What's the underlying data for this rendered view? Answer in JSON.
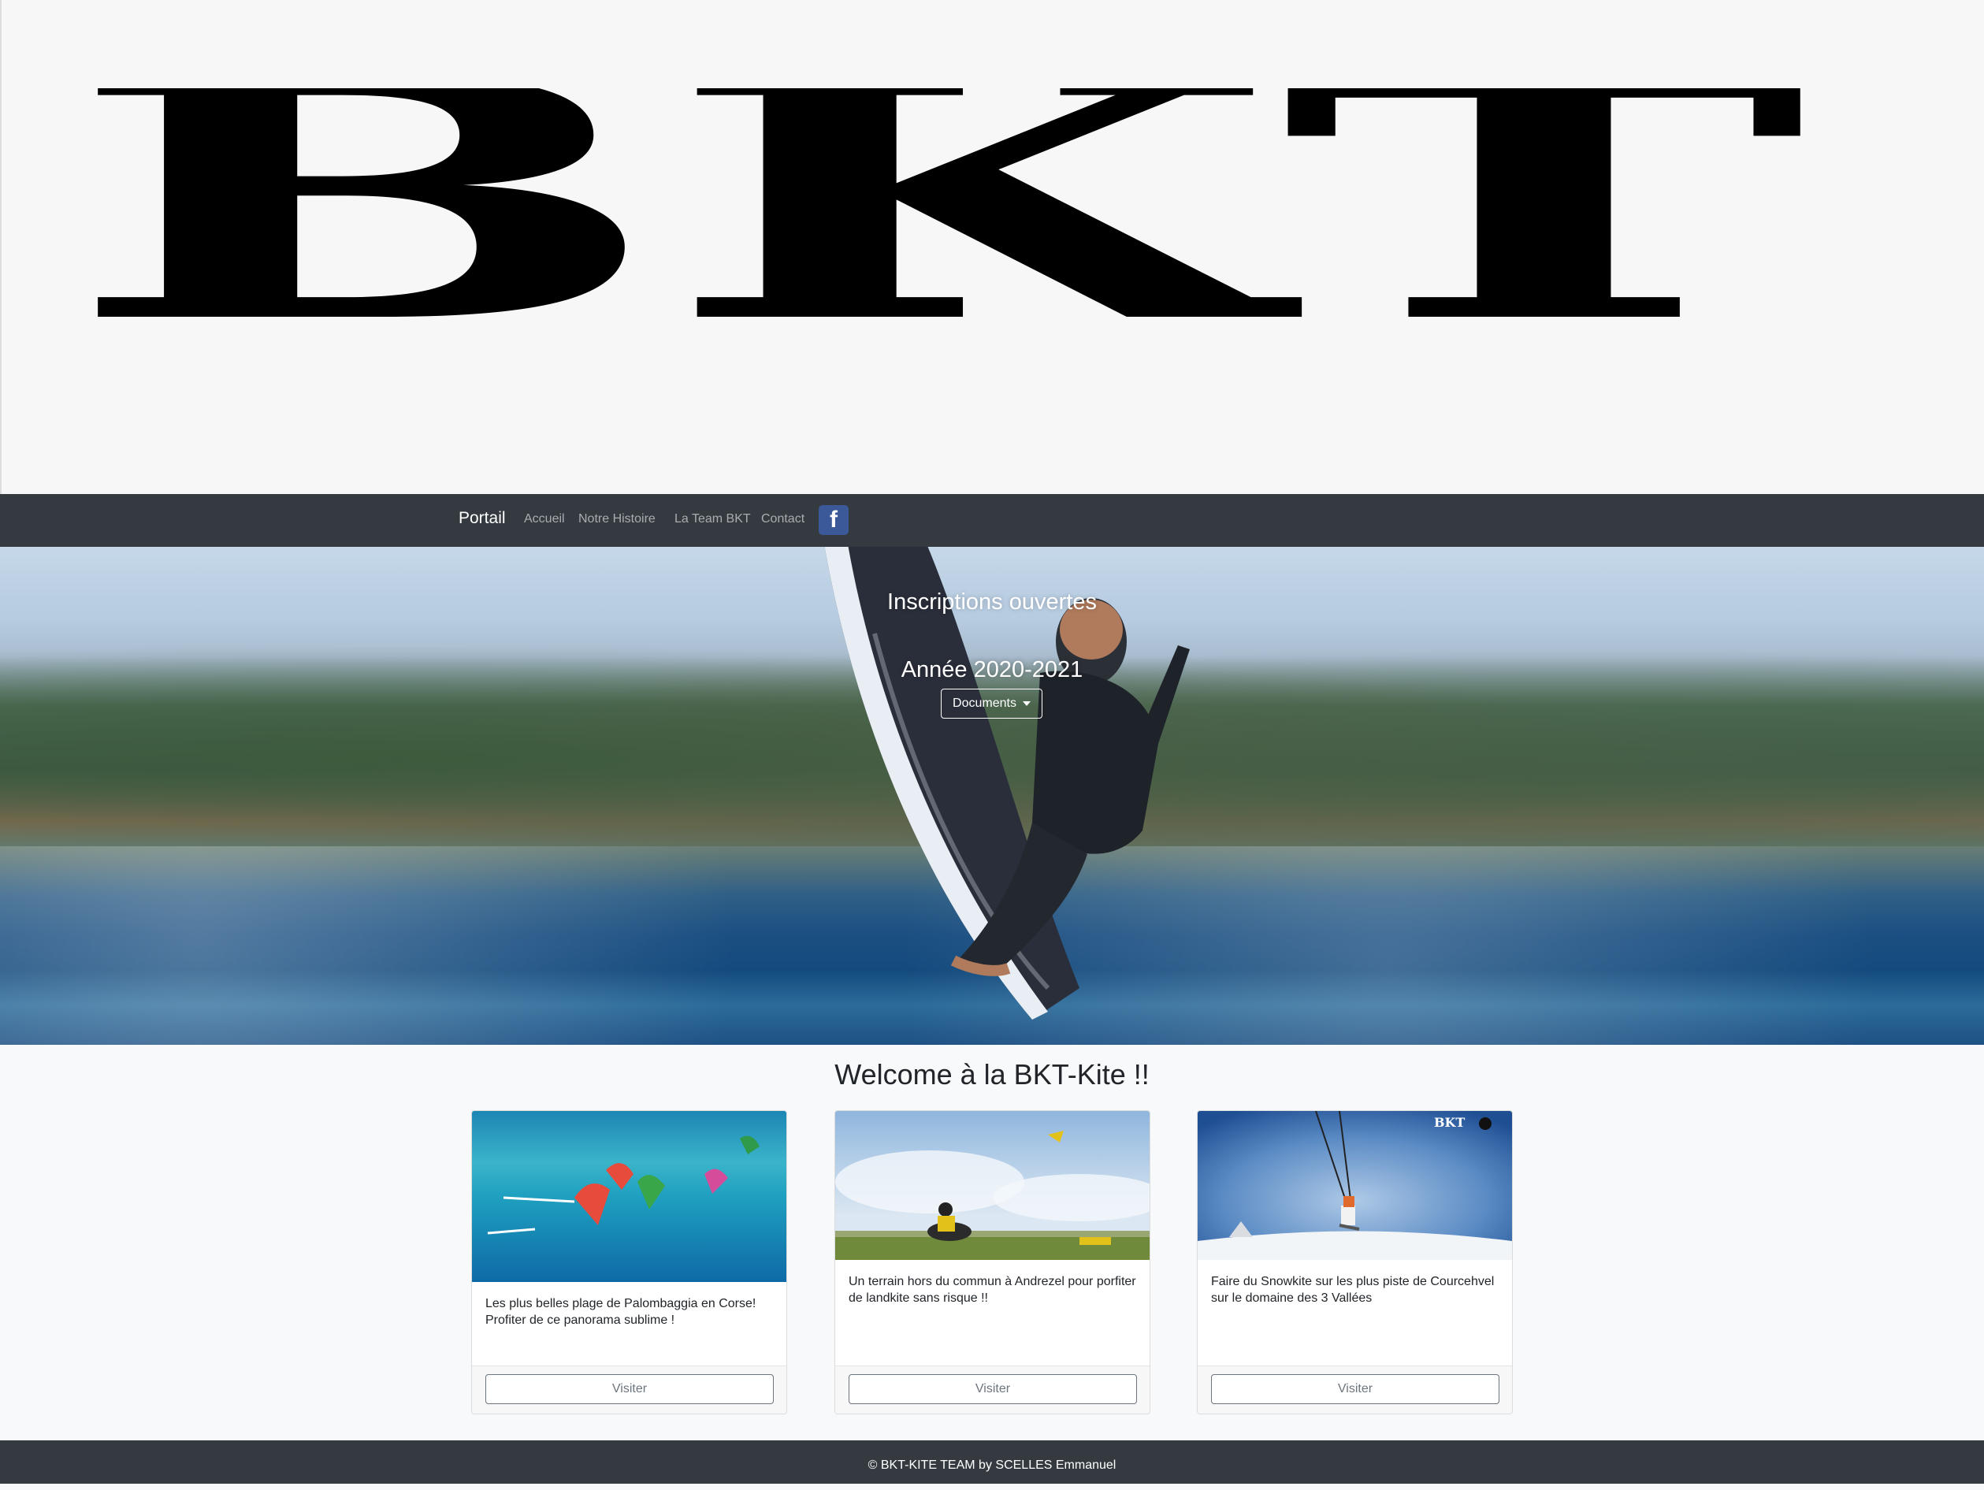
{
  "logo": {
    "text": "BKT"
  },
  "navbar": {
    "brand": "Portail",
    "links": [
      "Accueil",
      "Notre Histoire",
      "La Team BKT",
      "Contact"
    ],
    "facebook_icon": "facebook-icon"
  },
  "hero": {
    "title": "Inscriptions ouvertes",
    "subtitle": "Année 2020-2021",
    "dropdown_label": "Documents"
  },
  "welcome": "Welcome à la BKT-Kite !!",
  "cards": [
    {
      "text": "Les plus belles plage de Palombaggia en Corse! Profiter de ce panorama sublime !",
      "button": "Visiter"
    },
    {
      "text": "Un terrain hors du commun à Andrezel pour porfiter de landkite sans risque !!",
      "button": "Visiter"
    },
    {
      "text": "Faire du Snowkite sur les plus piste de Courcehvel sur le domaine des 3 Vallées",
      "button": "Visiter"
    }
  ],
  "card_badge": "BKT",
  "footer": "© BKT-KITE TEAM by SCELLES Emmanuel",
  "colors": {
    "navbar": "#343a40",
    "facebook": "#3b5998",
    "page": "#f8f9fa"
  }
}
